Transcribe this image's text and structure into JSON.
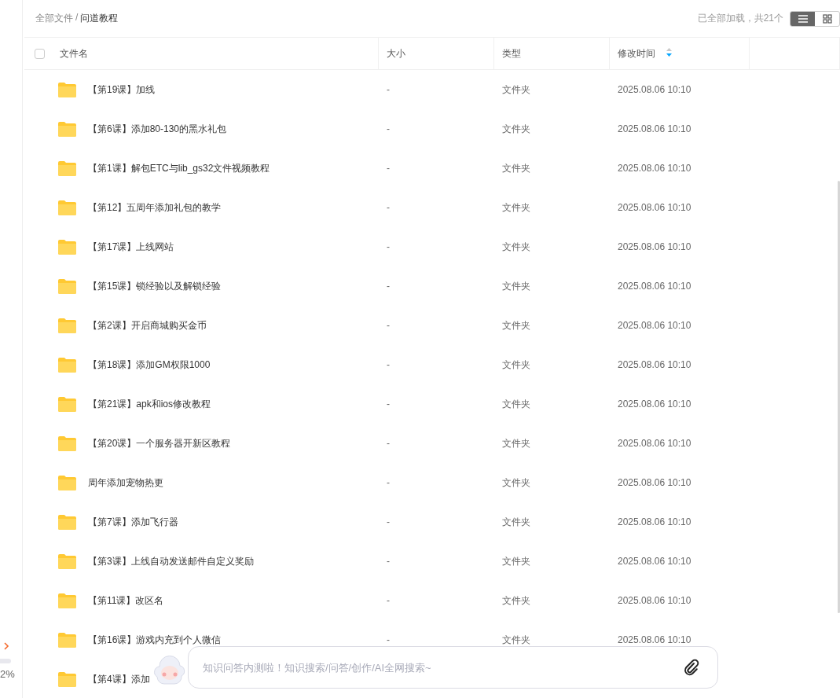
{
  "sidebar": {
    "percent": "2%"
  },
  "breadcrumb": {
    "items": [
      {
        "label": "全部文件",
        "current": false
      },
      {
        "label": "问道教程",
        "current": true
      }
    ],
    "separator": "/"
  },
  "status": "已全部加载，共21个",
  "view_modes": [
    {
      "kind": "list",
      "selected": true
    },
    {
      "kind": "grid",
      "selected": false
    }
  ],
  "table": {
    "select_all": {
      "checked": false
    },
    "columns": [
      {
        "label": "文件名"
      },
      {
        "label": "大小"
      },
      {
        "label": "类型"
      },
      {
        "label": "修改时间",
        "sorted_descending": true
      }
    ],
    "rows": [
      {
        "name": "【第19课】加线",
        "size": "-",
        "type": "文件夹",
        "modified": "2025.08.06 10:10"
      },
      {
        "name": "【第6课】添加80-130的黑水礼包",
        "size": "-",
        "type": "文件夹",
        "modified": "2025.08.06 10:10"
      },
      {
        "name": "【第1课】解包ETC与lib_gs32文件视频教程",
        "size": "-",
        "type": "文件夹",
        "modified": "2025.08.06 10:10"
      },
      {
        "name": "【第12】五周年添加礼包的教学",
        "size": "-",
        "type": "文件夹",
        "modified": "2025.08.06 10:10"
      },
      {
        "name": "【第17课】上线网站",
        "size": "-",
        "type": "文件夹",
        "modified": "2025.08.06 10:10"
      },
      {
        "name": "【第15课】锁经验以及解锁经验",
        "size": "-",
        "type": "文件夹",
        "modified": "2025.08.06 10:10"
      },
      {
        "name": "【第2课】开启商城购买金币",
        "size": "-",
        "type": "文件夹",
        "modified": "2025.08.06 10:10"
      },
      {
        "name": "【第18课】添加GM权限1000",
        "size": "-",
        "type": "文件夹",
        "modified": "2025.08.06 10:10"
      },
      {
        "name": "【第21课】apk和ios修改教程",
        "size": "-",
        "type": "文件夹",
        "modified": "2025.08.06 10:10"
      },
      {
        "name": "【第20课】一个服务器开新区教程",
        "size": "-",
        "type": "文件夹",
        "modified": "2025.08.06 10:10"
      },
      {
        "name": "周年添加宠物热更",
        "size": "-",
        "type": "文件夹",
        "modified": "2025.08.06 10:10"
      },
      {
        "name": "【第7课】添加飞行器",
        "size": "-",
        "type": "文件夹",
        "modified": "2025.08.06 10:10"
      },
      {
        "name": "【第3课】上线自动发送邮件自定义奖励",
        "size": "-",
        "type": "文件夹",
        "modified": "2025.08.06 10:10"
      },
      {
        "name": "【第11课】改区名",
        "size": "-",
        "type": "文件夹",
        "modified": "2025.08.06 10:10"
      },
      {
        "name": "【第16课】游戏内充到个人微信",
        "size": "-",
        "type": "文件夹",
        "modified": "2025.08.06 10:10"
      },
      {
        "name": "【第4课】添加"
      }
    ]
  },
  "chat": {
    "placeholder": "知识问答内测啦！知识搜索/问答/创作/AI全网搜索~"
  }
}
